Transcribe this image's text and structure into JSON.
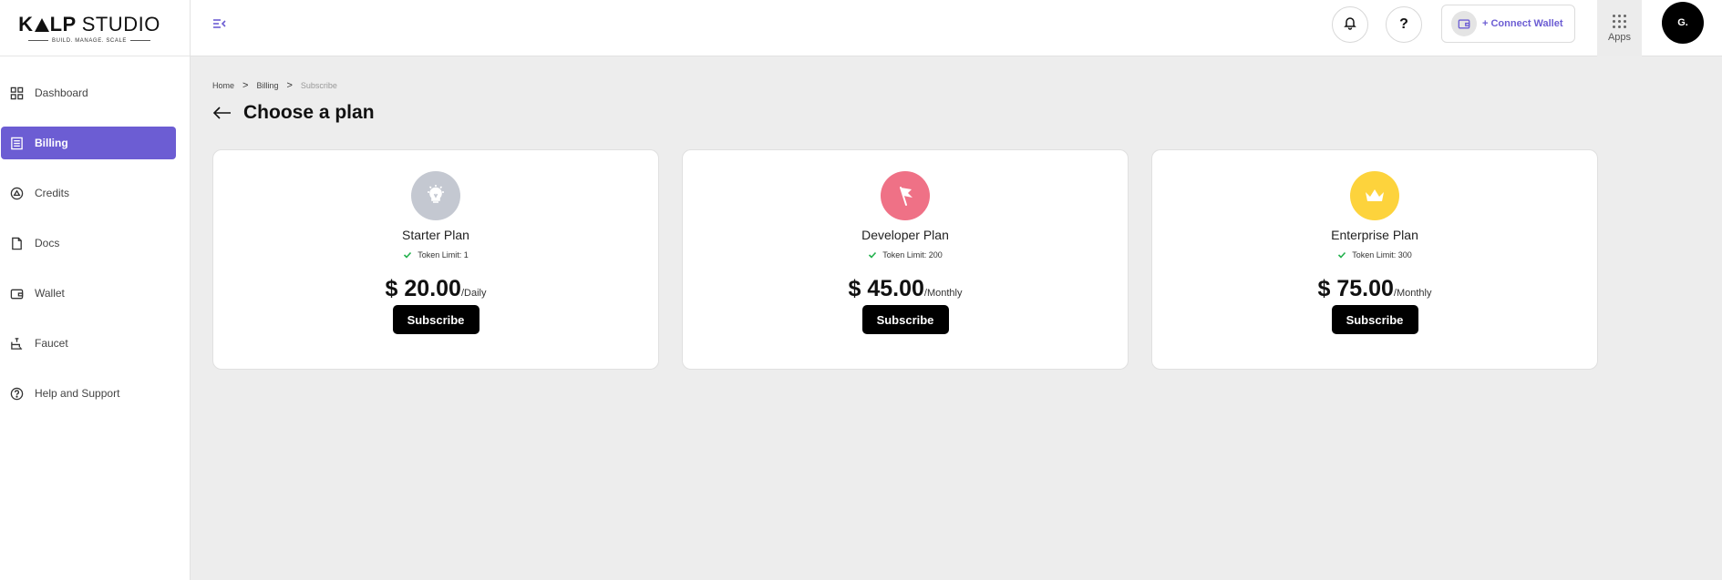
{
  "brand": {
    "name_left": "K",
    "name_mid": "LP",
    "name_right": "STUDIO",
    "tagline": "BUILD. MANAGE. SCALE"
  },
  "sidebar": {
    "items": [
      {
        "label": "Dashboard",
        "icon": "dashboard-icon"
      },
      {
        "label": "Billing",
        "icon": "billing-icon",
        "active": true
      },
      {
        "label": "Credits",
        "icon": "credits-icon"
      },
      {
        "label": "Docs",
        "icon": "docs-icon"
      },
      {
        "label": "Wallet",
        "icon": "wallet-icon"
      },
      {
        "label": "Faucet",
        "icon": "faucet-icon"
      },
      {
        "label": "Help and Support",
        "icon": "help-icon"
      }
    ]
  },
  "header": {
    "help_label": "?",
    "connect_wallet": "+ Connect Wallet",
    "apps_label": "Apps",
    "avatar_initials": "G."
  },
  "breadcrumb": {
    "home": "Home",
    "billing": "Billing",
    "current": "Subscribe",
    "separator": ">"
  },
  "page": {
    "title": "Choose a plan"
  },
  "plans": [
    {
      "name": "Starter Plan",
      "feature": "Token Limit: 1",
      "price": "$ 20.00",
      "period": "/Daily",
      "cta": "Subscribe",
      "icon": "lightbulb-icon",
      "color": "#c4c8d1"
    },
    {
      "name": "Developer Plan",
      "feature": "Token Limit: 200",
      "price": "$ 45.00",
      "period": "/Monthly",
      "cta": "Subscribe",
      "icon": "flag-icon",
      "color": "#ef7186"
    },
    {
      "name": "Enterprise Plan",
      "feature": "Token Limit: 300",
      "price": "$ 75.00",
      "period": "/Monthly",
      "cta": "Subscribe",
      "icon": "crown-icon",
      "color": "#fdd33c"
    }
  ],
  "colors": {
    "accent": "#6c5dd3",
    "check": "#22b14c",
    "background": "#ededed"
  }
}
